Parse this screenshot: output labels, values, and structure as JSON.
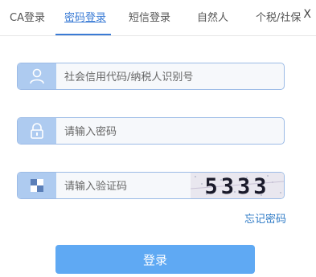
{
  "tabs": [
    {
      "label": "CA登录"
    },
    {
      "label": "密码登录"
    },
    {
      "label": "短信登录"
    },
    {
      "label": "自然人"
    },
    {
      "label": "个税/社保"
    }
  ],
  "close_label": "X",
  "fields": {
    "credit_code": {
      "placeholder": "社会信用代码/纳税人识别号",
      "icon": "user-icon"
    },
    "password": {
      "placeholder": "请输入密码",
      "icon": "lock-icon"
    },
    "captcha": {
      "placeholder": "请输入验证码",
      "icon": "captcha-icon",
      "captcha_text": "5333"
    }
  },
  "forgot_password": "忘记密码",
  "login_button": "登录",
  "colors": {
    "accent": "#3a7bd5",
    "button": "#5fa9f3",
    "icon_bg": "#aecbf0"
  }
}
